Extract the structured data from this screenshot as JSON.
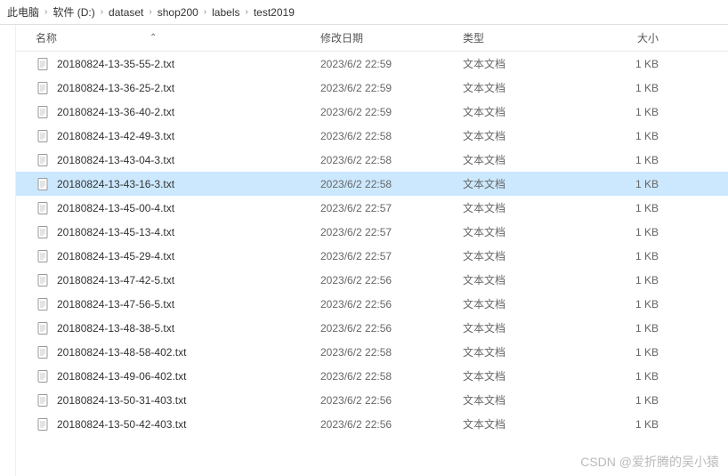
{
  "breadcrumb": [
    "此电脑",
    "软件 (D:)",
    "dataset",
    "shop200",
    "labels",
    "test2019"
  ],
  "columns": {
    "name": "名称",
    "date": "修改日期",
    "type": "类型",
    "size": "大小"
  },
  "file_type_label": "文本文档",
  "files": [
    {
      "name": "20180824-13-35-55-2.txt",
      "date": "2023/6/2 22:59",
      "size": "1 KB"
    },
    {
      "name": "20180824-13-36-25-2.txt",
      "date": "2023/6/2 22:59",
      "size": "1 KB"
    },
    {
      "name": "20180824-13-36-40-2.txt",
      "date": "2023/6/2 22:59",
      "size": "1 KB"
    },
    {
      "name": "20180824-13-42-49-3.txt",
      "date": "2023/6/2 22:58",
      "size": "1 KB"
    },
    {
      "name": "20180824-13-43-04-3.txt",
      "date": "2023/6/2 22:58",
      "size": "1 KB"
    },
    {
      "name": "20180824-13-43-16-3.txt",
      "date": "2023/6/2 22:58",
      "size": "1 KB",
      "selected": true
    },
    {
      "name": "20180824-13-45-00-4.txt",
      "date": "2023/6/2 22:57",
      "size": "1 KB"
    },
    {
      "name": "20180824-13-45-13-4.txt",
      "date": "2023/6/2 22:57",
      "size": "1 KB"
    },
    {
      "name": "20180824-13-45-29-4.txt",
      "date": "2023/6/2 22:57",
      "size": "1 KB"
    },
    {
      "name": "20180824-13-47-42-5.txt",
      "date": "2023/6/2 22:56",
      "size": "1 KB"
    },
    {
      "name": "20180824-13-47-56-5.txt",
      "date": "2023/6/2 22:56",
      "size": "1 KB"
    },
    {
      "name": "20180824-13-48-38-5.txt",
      "date": "2023/6/2 22:56",
      "size": "1 KB"
    },
    {
      "name": "20180824-13-48-58-402.txt",
      "date": "2023/6/2 22:58",
      "size": "1 KB"
    },
    {
      "name": "20180824-13-49-06-402.txt",
      "date": "2023/6/2 22:58",
      "size": "1 KB"
    },
    {
      "name": "20180824-13-50-31-403.txt",
      "date": "2023/6/2 22:56",
      "size": "1 KB"
    },
    {
      "name": "20180824-13-50-42-403.txt",
      "date": "2023/6/2 22:56",
      "size": "1 KB"
    }
  ],
  "watermark": "CSDN @爱折腾的吴小猿"
}
